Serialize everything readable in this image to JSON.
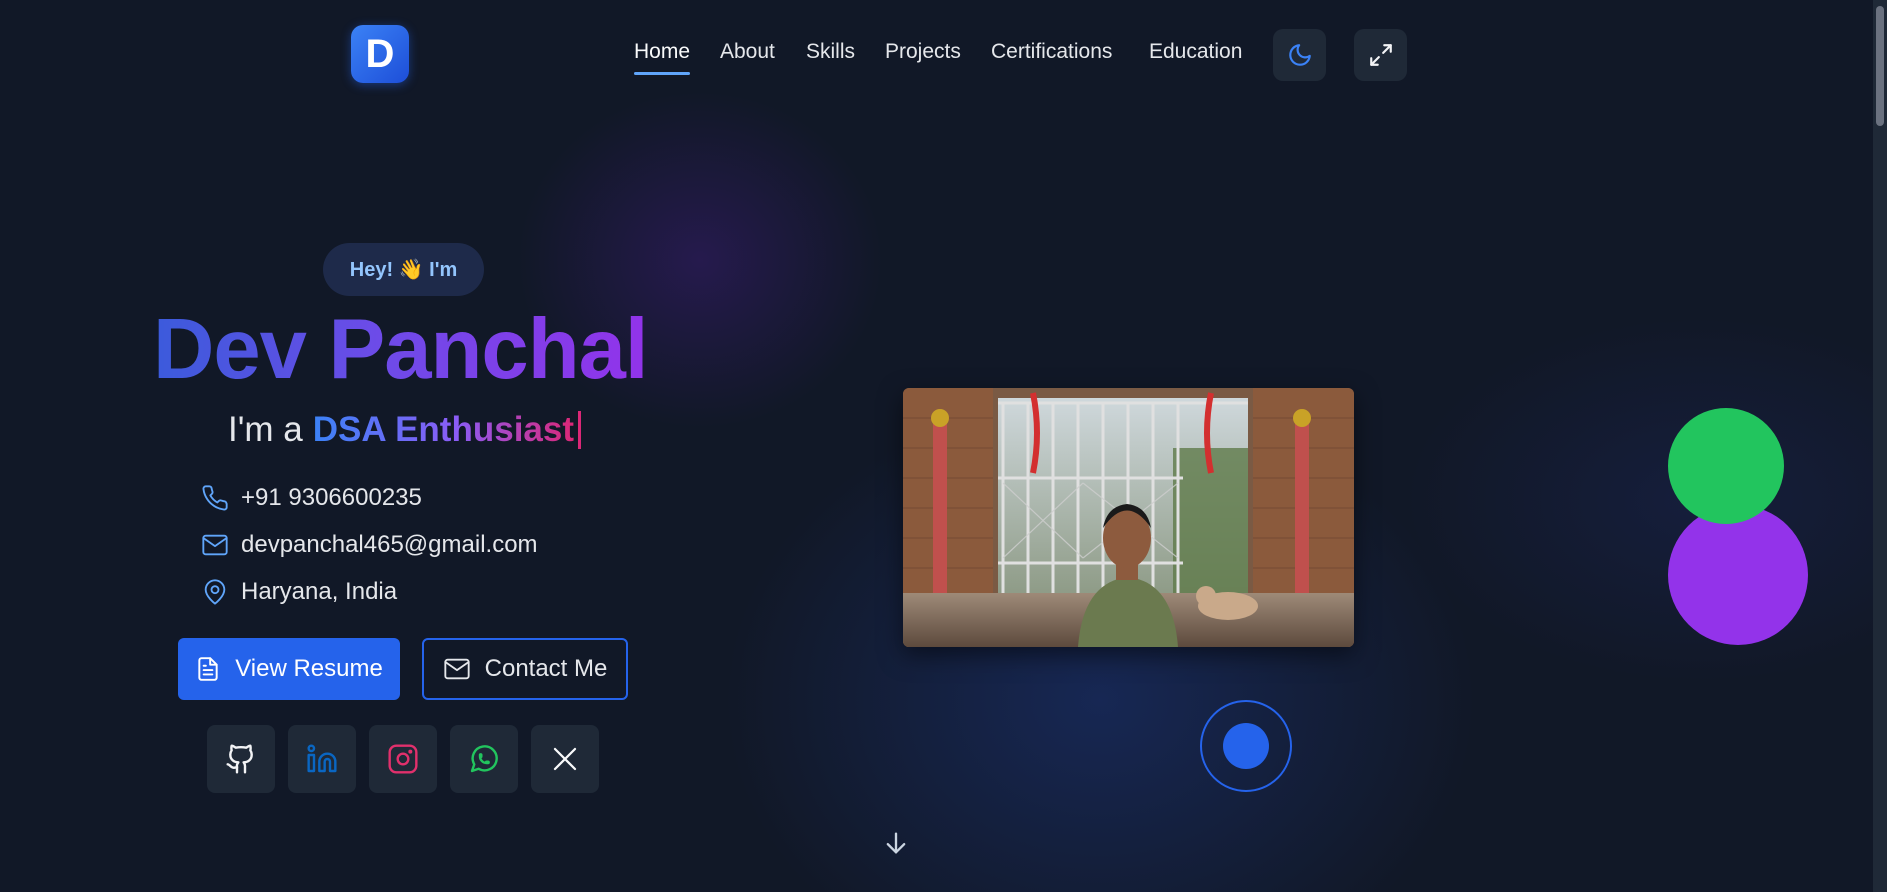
{
  "brand": {
    "logo_letter": "D"
  },
  "nav": {
    "items": [
      {
        "label": "Home",
        "active": true
      },
      {
        "label": "About"
      },
      {
        "label": "Skills"
      },
      {
        "label": "Projects"
      },
      {
        "label": "Certifications"
      },
      {
        "label": "Education"
      }
    ],
    "theme_toggle_icon": "moon-icon",
    "fullscreen_icon": "expand-icon"
  },
  "hero": {
    "greeting": "Hey! 👋 I'm",
    "name": "Dev Panchal",
    "tagline_prefix": "I'm a",
    "tagline_role": "DSA Enthusiast",
    "contact": {
      "phone": "+91 9306600235",
      "email": "devpanchal465@gmail.com",
      "location": "Haryana, India"
    },
    "buttons": {
      "resume": "View Resume",
      "contact": "Contact Me"
    },
    "socials": [
      "github-icon",
      "linkedin-icon",
      "instagram-icon",
      "whatsapp-icon",
      "x-icon"
    ]
  },
  "colors": {
    "background": "#111827",
    "accent": "#2563eb",
    "green_blob": "#22c55e",
    "purple_blob": "#9333ea"
  }
}
